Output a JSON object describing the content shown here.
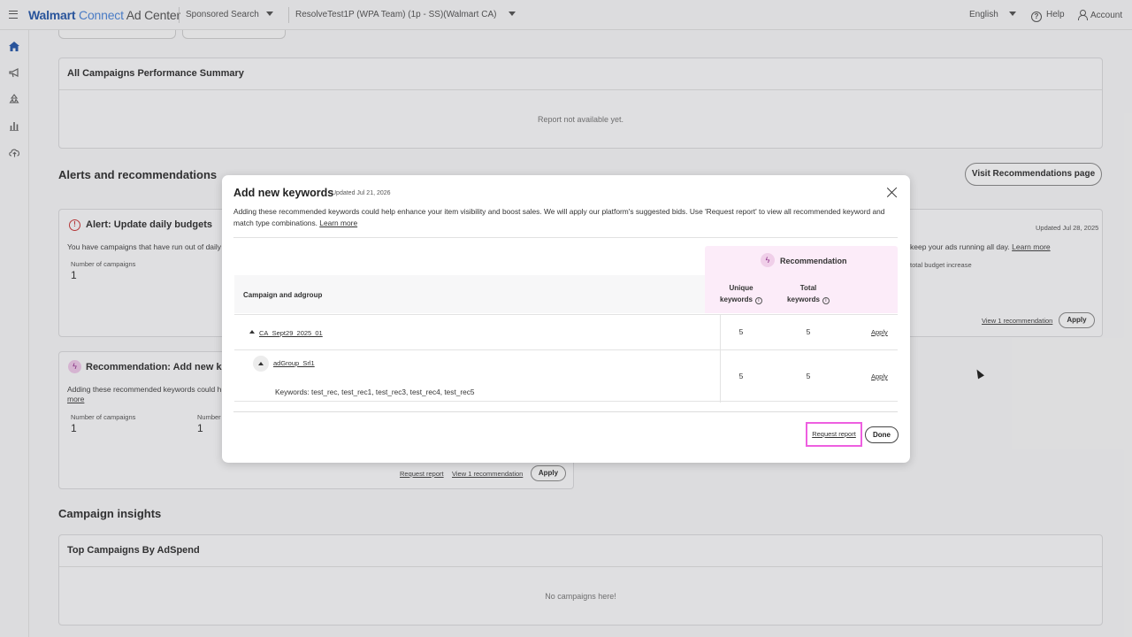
{
  "topbar": {
    "brand_walmart": "Walmart",
    "brand_connect": "Connect",
    "brand_adcenter": "Ad Center",
    "product_dropdown": "Sponsored Search",
    "account_dropdown": "ResolveTest1P (WPA Team) (1p - SS)(Walmart CA)",
    "language": "English",
    "help": "Help",
    "account": "Account"
  },
  "sidenav": {
    "icons": [
      "home-icon",
      "megaphone-icon",
      "recycle-icon",
      "bar-chart-icon",
      "cloud-upload-icon"
    ],
    "active": "home-icon",
    "accent_color": "#2a5aa8"
  },
  "performance_summary": {
    "title": "All Campaigns Performance Summary",
    "empty_message": "Report not available yet."
  },
  "alerts_section": {
    "title": "Alerts and recommendations",
    "visit_button": "Visit Recommendations page"
  },
  "alert_card": {
    "title": "Alert: Update daily budgets",
    "description": "You have campaigns that have run out of daily b",
    "campaigns_label": "Number of campaigns",
    "campaigns_value": "1"
  },
  "right_card": {
    "updated": "Updated Jul 28, 2025",
    "description": "keep your ads running all day.",
    "learn_more": "Learn more",
    "sub_label": "total budget increase",
    "view_link": "View 1 recommendation",
    "apply": "Apply"
  },
  "rec_card": {
    "title": "Recommendation: Add new key",
    "description": "Adding these recommended keywords could h",
    "more": "more",
    "campaigns_label": "Number of campaigns",
    "campaigns_value": "1",
    "number_label": "Number",
    "number_value": "1",
    "request_report": "Request report",
    "view_link": "View 1 recommendation",
    "apply": "Apply"
  },
  "insights": {
    "title": "Campaign insights",
    "card_title": "Top Campaigns By AdSpend",
    "empty_message": "No campaigns here!"
  },
  "modal": {
    "title": "Add new keywords",
    "updated": "Updated Jul 21, 2026",
    "description": "Adding these recommended keywords could help enhance your item visibility and boost sales. We will apply our platform's suggested bids. Use 'Request report' to view all recommended keyword and match type combinations.",
    "learn_more": "Learn more",
    "recommendation_header": "Recommendation",
    "col_campaign": "Campaign and adgroup",
    "col_unique_1": "Unique",
    "col_unique_2": "keywords",
    "col_total_1": "Total",
    "col_total_2": "keywords",
    "rows": [
      {
        "name": "CA_Sept29_2025_01",
        "unique": "5",
        "total": "5",
        "action": "Apply"
      },
      {
        "name": "adGroup_Srl1",
        "unique": "5",
        "total": "5",
        "action": "Apply",
        "keywords": "Keywords: test_rec, test_rec1, test_rec3, test_rec4, test_rec5"
      }
    ],
    "request_report": "Request report",
    "done": "Done",
    "highlight_color": "#ee5fe0"
  }
}
